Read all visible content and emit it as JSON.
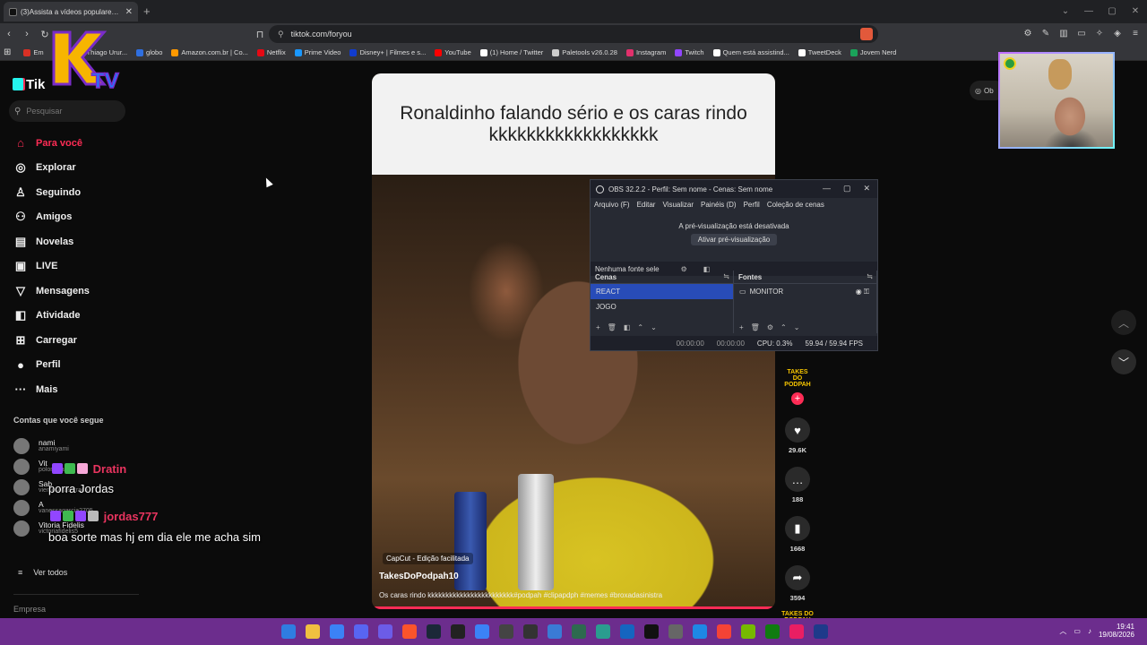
{
  "browser": {
    "tab_title": "(3)Assista a vídeos populares pa",
    "url": "tiktok.com/foryou",
    "bookmarks": [
      {
        "label": "Em",
        "color": "#d93025"
      },
      {
        "label": "Email – Thiago Urur...",
        "color": "#2f6fe0"
      },
      {
        "label": "globo",
        "color": "#2f6fe0"
      },
      {
        "label": "Amazon.com.br | Co...",
        "color": "#ff9900"
      },
      {
        "label": "Netflix",
        "color": "#e50914"
      },
      {
        "label": "Prime Video",
        "color": "#1a98ff"
      },
      {
        "label": "Disney+ | Filmes e s...",
        "color": "#113ccf"
      },
      {
        "label": "YouTube",
        "color": "#ff0000"
      },
      {
        "label": "(1) Home / Twitter",
        "color": "#ffffff"
      },
      {
        "label": "Paletools v26.0.28",
        "color": "#cccccc"
      },
      {
        "label": "Instagram",
        "color": "#e1306c"
      },
      {
        "label": "Twitch",
        "color": "#9146ff"
      },
      {
        "label": "Quem está assistind...",
        "color": "#ffffff"
      },
      {
        "label": "TweetDeck",
        "color": "#ffffff"
      },
      {
        "label": "Jovem Nerd",
        "color": "#1aa35a"
      }
    ]
  },
  "overlay": {
    "badge_text": "TV"
  },
  "tiktok": {
    "logo": "Tik",
    "search_placeholder": "Pesquisar",
    "nav": [
      {
        "label": "Para você",
        "icon": "home-icon",
        "glyph": "⌂",
        "active": true
      },
      {
        "label": "Explorar",
        "icon": "compass-icon",
        "glyph": "◎",
        "active": false
      },
      {
        "label": "Seguindo",
        "icon": "following-icon",
        "glyph": "♙",
        "active": false
      },
      {
        "label": "Amigos",
        "icon": "friends-icon",
        "glyph": "⚇",
        "active": false
      },
      {
        "label": "Novelas",
        "icon": "novelas-icon",
        "glyph": "▤",
        "active": false
      },
      {
        "label": "LIVE",
        "icon": "live-icon",
        "glyph": "▣",
        "active": false
      },
      {
        "label": "Mensagens",
        "icon": "messages-icon",
        "glyph": "▽",
        "active": false
      },
      {
        "label": "Atividade",
        "icon": "activity-icon",
        "glyph": "◧",
        "active": false
      },
      {
        "label": "Carregar",
        "icon": "upload-icon",
        "glyph": "⊞",
        "active": false
      },
      {
        "label": "Perfil",
        "icon": "profile-icon",
        "glyph": "●",
        "active": false
      },
      {
        "label": "Mais",
        "icon": "more-icon",
        "glyph": "···",
        "active": false
      }
    ],
    "following_header": "Contas que você segue",
    "following": [
      {
        "name": "nami",
        "handle": "anamiyami"
      },
      {
        "name": "Vit",
        "handle": "polomofato"
      },
      {
        "name": "Sab",
        "handle": "viemospraestrada"
      },
      {
        "name": "A",
        "handle": "vanessagarcia2705"
      },
      {
        "name": "Vitoria Fidelis",
        "handle": "victoriafidelis5"
      }
    ],
    "see_all": "Ver todos",
    "footer": "Empresa",
    "top_right_button": "Ob"
  },
  "chat": [
    {
      "user": "Dratin",
      "message": "porra Jordas"
    },
    {
      "user": "jordas777",
      "message": "boa sorte mas hj em dia ele me acha sim"
    }
  ],
  "video": {
    "header_text": "Ronaldinho falando sério e os caras rindo kkkkkkkkkkkkkkkkkk",
    "capcut": "CapCut - Edição facilitada",
    "username": "TakesDoPodpah10",
    "caption": "Os caras rindo kkkkkkkkkkkkkkkkkkkkkkkk#podpah #clipapdph #memes #broxadasinistra",
    "creator_logo": "TAKES DO PODPAH",
    "likes": "29.6K",
    "comments": "188",
    "saves": "1668",
    "shares": "3594"
  },
  "obs": {
    "title": "OBS 32.2.2 - Perfil: Sem nome - Cenas: Sem nome",
    "menu": [
      "Arquivo (F)",
      "Editar",
      "Visualizar",
      "Painéis (D)",
      "Perfil",
      "Coleção de cenas"
    ],
    "preview_disabled": "A pré-visualização está desativada",
    "enable_preview": "Ativar pré-visualização",
    "no_source": "Nenhuma fonte sele",
    "scenes_header": "Cenas",
    "scenes": [
      "REACT",
      "JOGO"
    ],
    "sources_header": "Fontes",
    "sources": [
      "MONITOR"
    ],
    "time1": "00:00:00",
    "time2": "00:00:00",
    "cpu": "CPU: 0.3%",
    "fps": "59.94 / 59.94 FPS"
  },
  "taskbar": {
    "time": "19:41",
    "date": "19/08/2026",
    "icon_colors": [
      "#2f7de1",
      "#f0c040",
      "#3b82f6",
      "#5865f2",
      "#6c5ce7",
      "#fb542b",
      "#1b2838",
      "#222222",
      "#3b82f6",
      "#444444",
      "#333333",
      "#3a7bd5",
      "#2d6a4f",
      "#2a9d8f",
      "#1565c0",
      "#111111",
      "#666666",
      "#1e88e5",
      "#f44336",
      "#76b900",
      "#107c10",
      "#e91e63",
      "#1e3a8a"
    ]
  }
}
